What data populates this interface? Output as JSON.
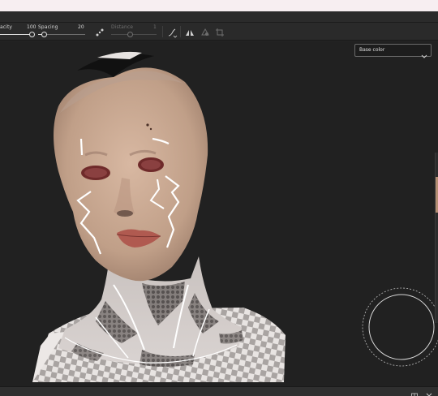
{
  "toolbar": {
    "opacity_label": "acity",
    "opacity_value": "100",
    "opacity_fraction": 1.0,
    "spacing_label": "Spacing",
    "spacing_value": "20",
    "spacing_fraction": 0.2,
    "distance_label": "Distance",
    "distance_value": "1",
    "icons": [
      "spacing-dots-icon",
      "lazy-mouse-icon",
      "symmetry-icon",
      "stencil-icon",
      "transform-icon"
    ]
  },
  "viewport": {
    "channel_select_value": "Base color",
    "brush_cursor": "brush-cursor-circle"
  },
  "bottom_bar": {
    "icons": [
      "panel-dock-icon",
      "close-icon"
    ]
  },
  "colors": {
    "background": "#212121",
    "toolbar": "#2a2a2a",
    "accent_text": "#d8d8d8"
  }
}
